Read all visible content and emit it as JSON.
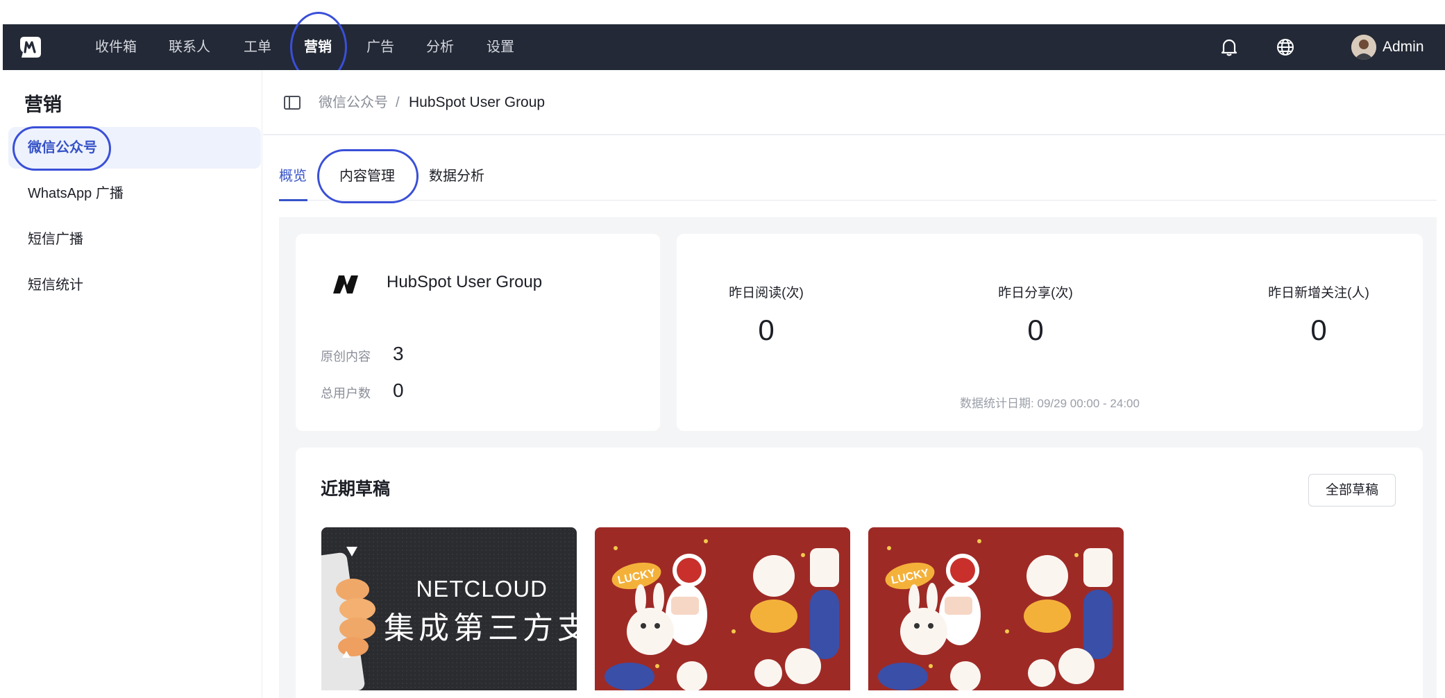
{
  "app": {
    "nav": [
      {
        "label": "收件箱"
      },
      {
        "label": "联系人"
      },
      {
        "label": "工单"
      },
      {
        "label": "营销"
      },
      {
        "label": "广告"
      },
      {
        "label": "分析"
      },
      {
        "label": "设置"
      }
    ],
    "active_nav": "营销",
    "user_name": "Admin",
    "icons": {
      "notifications": "bell-icon",
      "language": "globe-icon"
    }
  },
  "sidebar": {
    "title": "营销",
    "items": [
      {
        "label": "微信公众号",
        "active": true
      },
      {
        "label": "WhatsApp 广播"
      },
      {
        "label": "短信广播"
      },
      {
        "label": "短信统计"
      }
    ]
  },
  "breadcrumb": {
    "parent": "微信公众号",
    "separator": "/",
    "current": "HubSpot User Group"
  },
  "tabs": [
    {
      "label": "概览",
      "active": true
    },
    {
      "label": "内容管理"
    },
    {
      "label": "数据分析"
    }
  ],
  "account": {
    "name": "HubSpot User Group",
    "original_label": "原创内容",
    "original_value": "3",
    "users_label": "总用户数",
    "users_value": "0"
  },
  "stats": {
    "items": [
      {
        "label": "昨日阅读(次)",
        "value": "0"
      },
      {
        "label": "昨日分享(次)",
        "value": "0"
      },
      {
        "label": "昨日新增关注(人)",
        "value": "0"
      }
    ],
    "date_note": "数据统计日期: 09/29 00:00 - 24:00"
  },
  "drafts": {
    "title": "近期草稿",
    "all_button": "全部草稿",
    "cards": [
      {
        "cover_line1": "NETCLOUD",
        "cover_line2": "集成第三方支"
      },
      {
        "cover_text": "LUCKY"
      },
      {
        "cover_text": "LUCKY"
      }
    ]
  },
  "colors": {
    "topbar": "#232936",
    "accent": "#3653c8",
    "annotation_ring": "#3a4fd8",
    "content_bg": "#f4f5f7",
    "festive_red": "#9e2a26"
  }
}
